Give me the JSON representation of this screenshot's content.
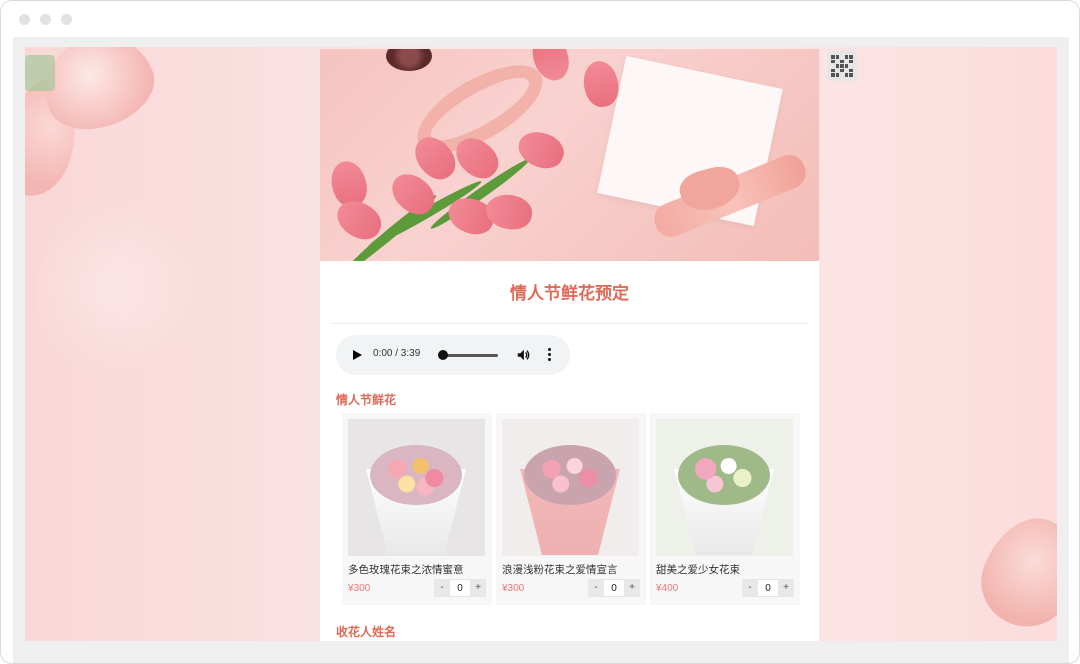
{
  "page": {
    "title": "情人节鲜花预定"
  },
  "audio": {
    "time": "0:00 / 3:39"
  },
  "sections": {
    "flowers_label": "情人节鲜花",
    "recipient_label": "收花人姓名"
  },
  "products": [
    {
      "name": "多色玫瑰花束之浓情蜜意",
      "price": "¥300",
      "qty": "0",
      "minus": "-",
      "plus": "+"
    },
    {
      "name": "浪漫浅粉花束之爱情宣言",
      "price": "¥300",
      "qty": "0",
      "minus": "-",
      "plus": "+"
    },
    {
      "name": "甜美之爱少女花束",
      "price": "¥400",
      "qty": "0",
      "minus": "-",
      "plus": "+"
    }
  ],
  "colors": {
    "accent": "#e06a58",
    "price": "#e8777a",
    "background": "#fbe4e4"
  },
  "icons": {
    "qr": "qr-code-icon",
    "play": "play-icon",
    "volume": "volume-icon",
    "more": "more-vert-icon"
  }
}
